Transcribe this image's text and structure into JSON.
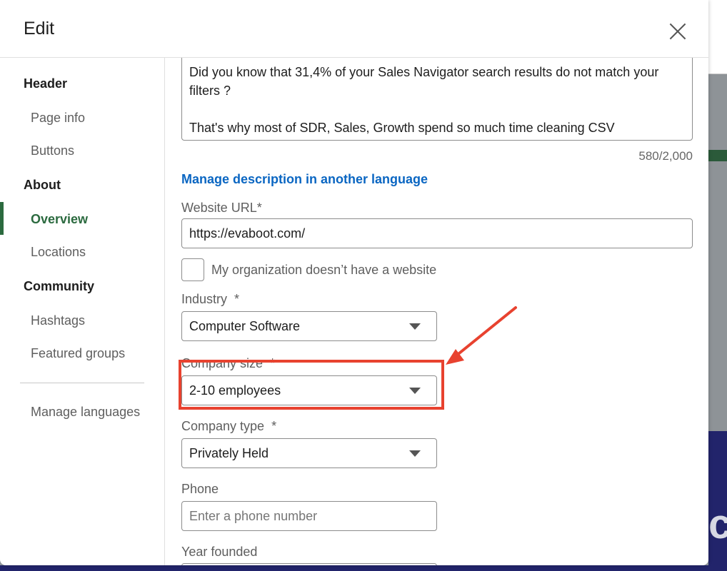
{
  "modal": {
    "title": "Edit",
    "close_icon": "close-icon"
  },
  "sidebar": {
    "sections": [
      {
        "heading": "Header",
        "items": [
          "Page info",
          "Buttons"
        ]
      },
      {
        "heading": "About",
        "items": [
          "Overview",
          "Locations"
        ]
      },
      {
        "heading": "Community",
        "items": [
          "Hashtags",
          "Featured groups"
        ]
      }
    ],
    "active_item": "Overview",
    "manage_languages": "Manage languages"
  },
  "form": {
    "description_text": "Did you know that 31,4% of your Sales Navigator search results do not match your filters ?\n\nThat's why most of SDR, Sales, Growth spend so much time cleaning CSV",
    "char_count": "580/2,000",
    "manage_description_link": "Manage description in another language",
    "website_label": "Website URL",
    "website_value": "https://evaboot.com/",
    "no_website_label": "My organization doesn’t have a website",
    "industry_label": "Industry",
    "industry_value": "Computer Software",
    "company_size_label": "Company size",
    "company_size_value": "2-10 employees",
    "company_type_label": "Company type",
    "company_type_value": "Privately Held",
    "phone_label": "Phone",
    "phone_placeholder": "Enter a phone number",
    "year_founded_label": "Year founded",
    "required_mark": "*"
  },
  "background": {
    "partial_text": "cl"
  },
  "colors": {
    "accent_green": "#2b6a3f",
    "link_blue": "#0a66c2",
    "annotation_red": "#e8422f"
  }
}
